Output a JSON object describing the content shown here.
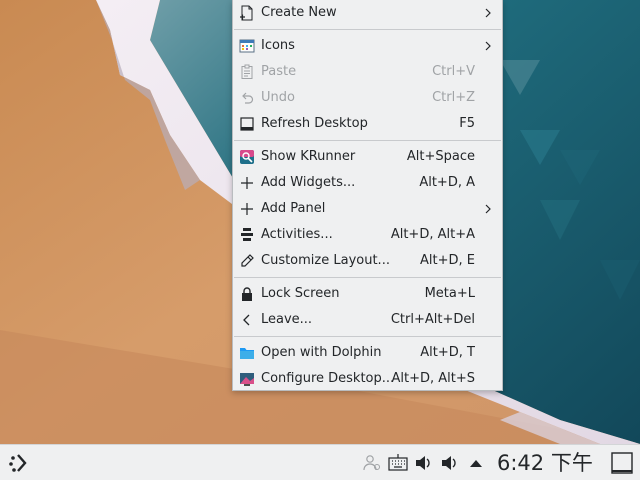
{
  "context_menu": {
    "items": [
      {
        "label": "Create New",
        "shortcut": "",
        "submenu": true,
        "enabled": true,
        "icon": "document-new-icon"
      },
      {
        "label": "Icons",
        "shortcut": "",
        "submenu": true,
        "enabled": true,
        "icon": "view-icons-icon"
      },
      {
        "label": "Paste",
        "shortcut": "Ctrl+V",
        "submenu": false,
        "enabled": false,
        "icon": "clipboard-icon"
      },
      {
        "label": "Undo",
        "shortcut": "Ctrl+Z",
        "submenu": false,
        "enabled": false,
        "icon": "undo-icon"
      },
      {
        "label": "Refresh Desktop",
        "shortcut": "F5",
        "submenu": false,
        "enabled": true,
        "icon": "refresh-icon"
      },
      {
        "label": "Show KRunner",
        "shortcut": "Alt+Space",
        "submenu": false,
        "enabled": true,
        "icon": "krunner-icon"
      },
      {
        "label": "Add Widgets...",
        "shortcut": "Alt+D, A",
        "submenu": false,
        "enabled": true,
        "icon": "plus-icon"
      },
      {
        "label": "Add Panel",
        "shortcut": "",
        "submenu": true,
        "enabled": true,
        "icon": "plus-icon"
      },
      {
        "label": "Activities...",
        "shortcut": "Alt+D, Alt+A",
        "submenu": false,
        "enabled": true,
        "icon": "activities-icon"
      },
      {
        "label": "Customize Layout...",
        "shortcut": "Alt+D, E",
        "submenu": false,
        "enabled": true,
        "icon": "pencil-icon"
      },
      {
        "label": "Lock Screen",
        "shortcut": "Meta+L",
        "submenu": false,
        "enabled": true,
        "icon": "lock-icon"
      },
      {
        "label": "Leave...",
        "shortcut": "Ctrl+Alt+Del",
        "submenu": false,
        "enabled": true,
        "icon": "chevron-left-icon"
      },
      {
        "label": "Open with Dolphin",
        "shortcut": "Alt+D, T",
        "submenu": false,
        "enabled": true,
        "icon": "folder-icon"
      },
      {
        "label": "Configure Desktop...",
        "shortcut": "Alt+D, Alt+S",
        "submenu": false,
        "enabled": true,
        "icon": "preferences-desktop-wallpaper-icon"
      }
    ]
  },
  "panel": {
    "clock": "6:42 下午",
    "icons": [
      "app-launcher-icon",
      "user-presence-icon",
      "keyboard-icon",
      "volume-icon",
      "volume-icon",
      "tray-expand-arrow-icon",
      "show-desktop-icon"
    ]
  },
  "colors": {
    "panel_bg": "#eff0f1",
    "menu_bg": "#eff0f1",
    "disabled_text": "#a0a3a6",
    "accent_blue": "#3daee9"
  }
}
